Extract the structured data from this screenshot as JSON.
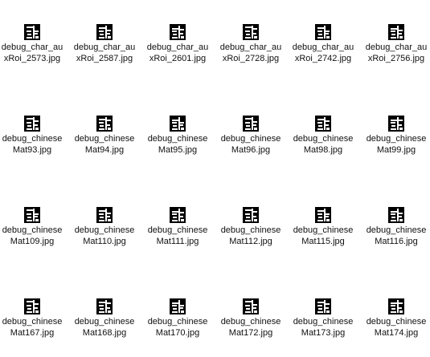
{
  "files": [
    {
      "line1": "debug_char_au",
      "line2": "xRoi_2573.jpg",
      "thumbnail": "character-glyph-thumbnail"
    },
    {
      "line1": "debug_char_au",
      "line2": "xRoi_2587.jpg",
      "thumbnail": "character-glyph-thumbnail"
    },
    {
      "line1": "debug_char_au",
      "line2": "xRoi_2601.jpg",
      "thumbnail": "character-glyph-thumbnail"
    },
    {
      "line1": "debug_char_au",
      "line2": "xRoi_2728.jpg",
      "thumbnail": "character-glyph-thumbnail"
    },
    {
      "line1": "debug_char_au",
      "line2": "xRoi_2742.jpg",
      "thumbnail": "character-glyph-thumbnail"
    },
    {
      "line1": "debug_char_au",
      "line2": "xRoi_2756.jpg",
      "thumbnail": "character-glyph-thumbnail"
    },
    {
      "line1": "debug_chinese",
      "line2": "Mat93.jpg",
      "thumbnail": "character-glyph-thumbnail"
    },
    {
      "line1": "debug_chinese",
      "line2": "Mat94.jpg",
      "thumbnail": "character-glyph-thumbnail"
    },
    {
      "line1": "debug_chinese",
      "line2": "Mat95.jpg",
      "thumbnail": "character-glyph-thumbnail"
    },
    {
      "line1": "debug_chinese",
      "line2": "Mat96.jpg",
      "thumbnail": "character-glyph-thumbnail"
    },
    {
      "line1": "debug_chinese",
      "line2": "Mat98.jpg",
      "thumbnail": "character-glyph-thumbnail"
    },
    {
      "line1": "debug_chinese",
      "line2": "Mat99.jpg",
      "thumbnail": "character-glyph-thumbnail"
    },
    {
      "line1": "debug_chinese",
      "line2": "Mat109.jpg",
      "thumbnail": "character-glyph-thumbnail"
    },
    {
      "line1": "debug_chinese",
      "line2": "Mat110.jpg",
      "thumbnail": "character-glyph-thumbnail"
    },
    {
      "line1": "debug_chinese",
      "line2": "Mat111.jpg",
      "thumbnail": "character-glyph-thumbnail"
    },
    {
      "line1": "debug_chinese",
      "line2": "Mat112.jpg",
      "thumbnail": "character-glyph-thumbnail"
    },
    {
      "line1": "debug_chinese",
      "line2": "Mat115.jpg",
      "thumbnail": "character-glyph-thumbnail"
    },
    {
      "line1": "debug_chinese",
      "line2": "Mat116.jpg",
      "thumbnail": "character-glyph-thumbnail"
    },
    {
      "line1": "debug_chinese",
      "line2": "Mat167.jpg",
      "thumbnail": "character-glyph-thumbnail"
    },
    {
      "line1": "debug_chinese",
      "line2": "Mat168.jpg",
      "thumbnail": "character-glyph-thumbnail"
    },
    {
      "line1": "debug_chinese",
      "line2": "Mat170.jpg",
      "thumbnail": "character-glyph-thumbnail"
    },
    {
      "line1": "debug_chinese",
      "line2": "Mat172.jpg",
      "thumbnail": "character-glyph-thumbnail"
    },
    {
      "line1": "debug_chinese",
      "line2": "Mat173.jpg",
      "thumbnail": "character-glyph-thumbnail"
    },
    {
      "line1": "debug_chinese",
      "line2": "Mat174.jpg",
      "thumbnail": "character-glyph-thumbnail"
    }
  ]
}
